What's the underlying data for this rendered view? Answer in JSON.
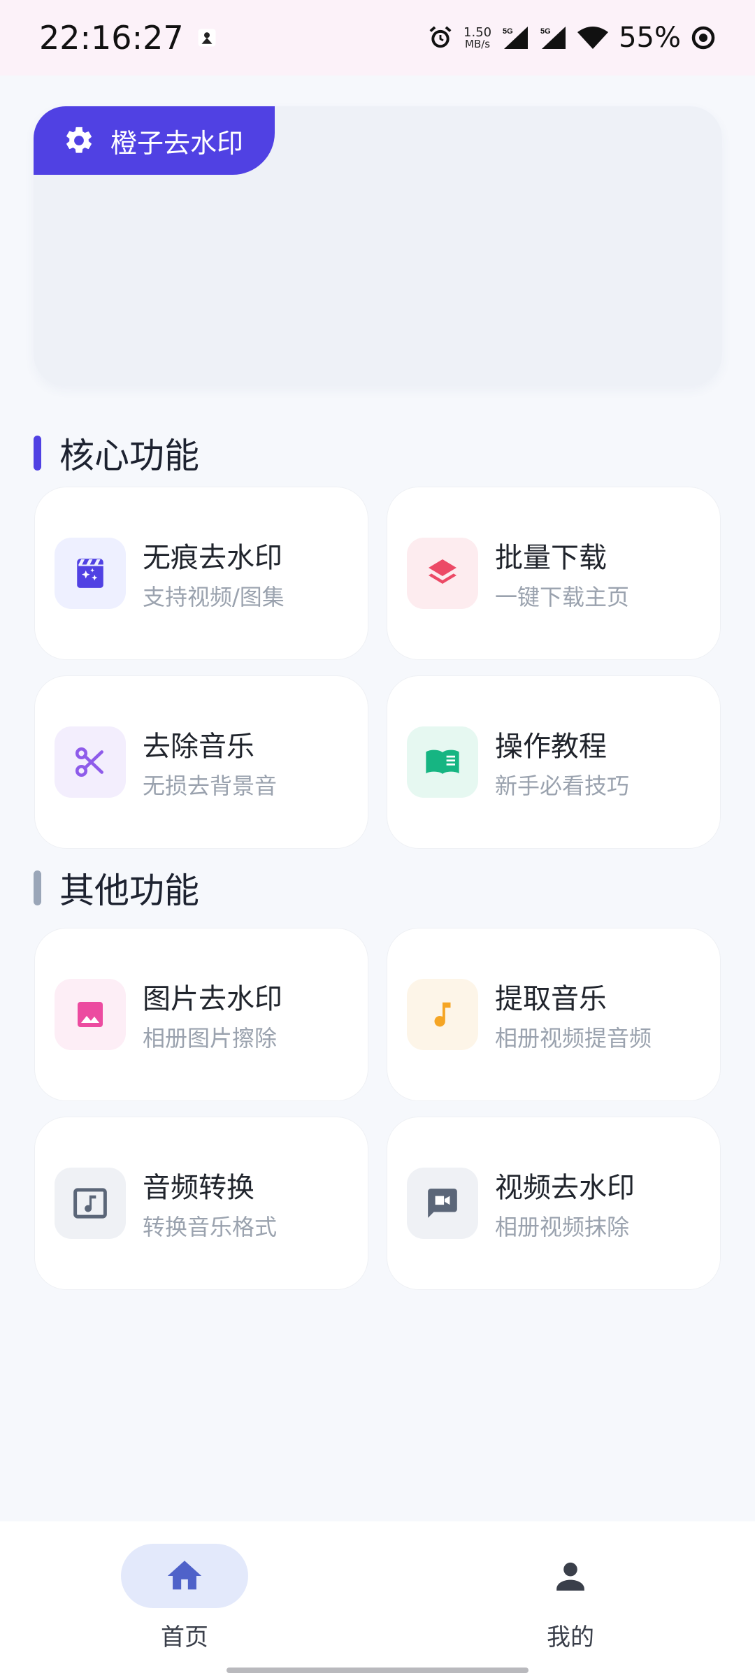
{
  "status_bar": {
    "time": "22:16:27",
    "net_speed_value": "1.50",
    "net_speed_unit": "MB/s",
    "signal_label_1": "5G",
    "signal_label_2": "5G",
    "battery": "55%"
  },
  "banner": {
    "tag_label": "橙子去水印",
    "tag_icon": "gear-icon",
    "tag_color": "#5041e3"
  },
  "sections": {
    "core": {
      "title": "核心功能",
      "bar_color": "#5041e3",
      "cards": [
        {
          "title": "无痕去水印",
          "subtitle": "支持视频/图集",
          "icon": "movie-sparkle-icon",
          "icon_color": "#5041e3",
          "icon_bg": "#eef0ff"
        },
        {
          "title": "批量下载",
          "subtitle": "一键下载主页",
          "icon": "layers-icon",
          "icon_color": "#ec4a66",
          "icon_bg": "#fdecef"
        },
        {
          "title": "去除音乐",
          "subtitle": "无损去背景音",
          "icon": "scissors-icon",
          "icon_color": "#8e5bea",
          "icon_bg": "#f3eefd"
        },
        {
          "title": "操作教程",
          "subtitle": "新手必看技巧",
          "icon": "book-icon",
          "icon_color": "#16b582",
          "icon_bg": "#e6f8f1"
        }
      ]
    },
    "other": {
      "title": "其他功能",
      "bar_color": "#9aa6b8",
      "cards": [
        {
          "title": "图片去水印",
          "subtitle": "相册图片擦除",
          "icon": "image-icon",
          "icon_color": "#ec4ba0",
          "icon_bg": "#fdeef6"
        },
        {
          "title": "提取音乐",
          "subtitle": "相册视频提音频",
          "icon": "music-note-icon",
          "icon_color": "#f5a524",
          "icon_bg": "#fdf5e8"
        },
        {
          "title": "音频转换",
          "subtitle": "转换音乐格式",
          "icon": "audio-file-icon",
          "icon_color": "#5b6678",
          "icon_bg": "#eff1f5"
        },
        {
          "title": "视频去水印",
          "subtitle": "相册视频抹除",
          "icon": "video-chat-icon",
          "icon_color": "#5b6678",
          "icon_bg": "#eff1f5"
        }
      ]
    }
  },
  "bottom_nav": {
    "items": [
      {
        "label": "首页",
        "icon": "home-icon",
        "active": true
      },
      {
        "label": "我的",
        "icon": "person-icon",
        "active": false
      }
    ],
    "active_bg": "#e3e9fb",
    "active_icon_color": "#4f62c9"
  }
}
